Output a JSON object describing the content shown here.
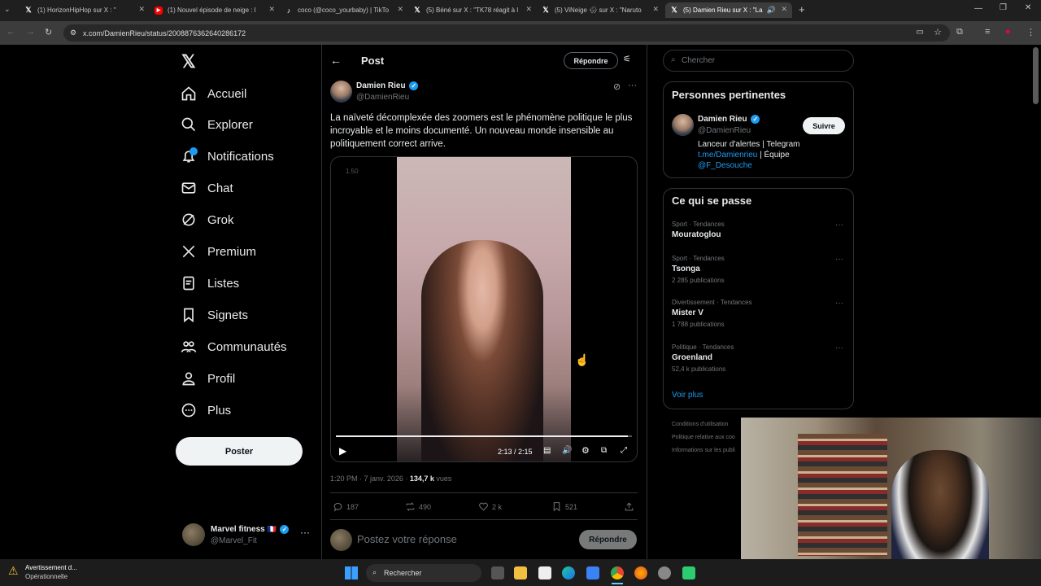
{
  "browser": {
    "tabs": [
      {
        "title": "(1) HorizonHipHop sur X : \"",
        "icon": "x-logo-icon"
      },
      {
        "title": "(1) Nouvel épisode de neige : l",
        "icon": "youtube-icon"
      },
      {
        "title": "coco (@coco_yourbaby) | TikTo",
        "icon": "tiktok-icon"
      },
      {
        "title": "(5) Béné sur X : \"TK78 réagit à l",
        "icon": "x-logo-icon"
      },
      {
        "title": "(5) ViNeige 🌨 sur X : \"Naruto",
        "icon": "x-logo-icon"
      },
      {
        "title": "(5) Damien Rieu sur X : \"La",
        "icon": "x-logo-icon",
        "active": true
      }
    ],
    "url": "x.com/DamienRieu/status/2008876362640286172"
  },
  "nav": {
    "items": [
      "Accueil",
      "Explorer",
      "Notifications",
      "Chat",
      "Grok",
      "Premium",
      "Listes",
      "Signets",
      "Communautés",
      "Profil",
      "Plus"
    ],
    "post_label": "Poster",
    "account": {
      "name": "Marvel fitness",
      "flag": "🇫🇷",
      "handle": "@Marvel_Fit"
    }
  },
  "main": {
    "header_title": "Post",
    "reply_button": "Répondre",
    "author": {
      "name": "Damien Rieu",
      "handle": "@DamienRieu"
    },
    "text": "La naïveté décomplexée des zoomers est le phénomène politique le plus incroyable et le moins documenté. Un nouveau monde insensible au politiquement correct arrive.",
    "video": {
      "watermark": "1.50",
      "time": "2:13 / 2:15",
      "progress": 0.985
    },
    "meta": {
      "time": "1:20 PM · 7 janv. 2026 · ",
      "views": "134,7 k",
      "views_label": " vues"
    },
    "actions": {
      "replies": "187",
      "reposts": "490",
      "likes": "2 k",
      "bookmarks": "521"
    },
    "reply_placeholder": "Postez votre réponse",
    "reply_submit": "Répondre"
  },
  "right": {
    "search_placeholder": "Chercher",
    "relevant_title": "Personnes pertinentes",
    "person": {
      "name": "Damien Rieu",
      "handle": "@DamienRieu",
      "bio": "Lanceur d'alertes | Telegram",
      "link": "t.me/Damienrieu",
      "bio_rest": " | Équipe",
      "mention": "@F_Desouche",
      "follow": "Suivre"
    },
    "trends_title": "Ce qui se passe",
    "trends": [
      {
        "category": "Sport · Tendances",
        "name": "Mouratoglou",
        "count": ""
      },
      {
        "category": "Sport · Tendances",
        "name": "Tsonga",
        "count": "2 285 publications"
      },
      {
        "category": "Divertissement · Tendances",
        "name": "Mister V",
        "count": "1 788 publications"
      },
      {
        "category": "Politique · Tendances",
        "name": "Groenland",
        "count": "52,4 k publications"
      }
    ],
    "see_more": "Voir plus",
    "footer": [
      "Conditions d'utilisation",
      "Politique relative aux coo",
      "Informations sur les publi"
    ]
  },
  "taskbar": {
    "warning_title": "Avertissement d...",
    "warning_sub": "Opérationnelle",
    "search": "Rechercher"
  },
  "colors": {
    "accent": "#1d9bf0",
    "bg": "#000000",
    "border": "#2f3336",
    "muted": "#71767b"
  }
}
